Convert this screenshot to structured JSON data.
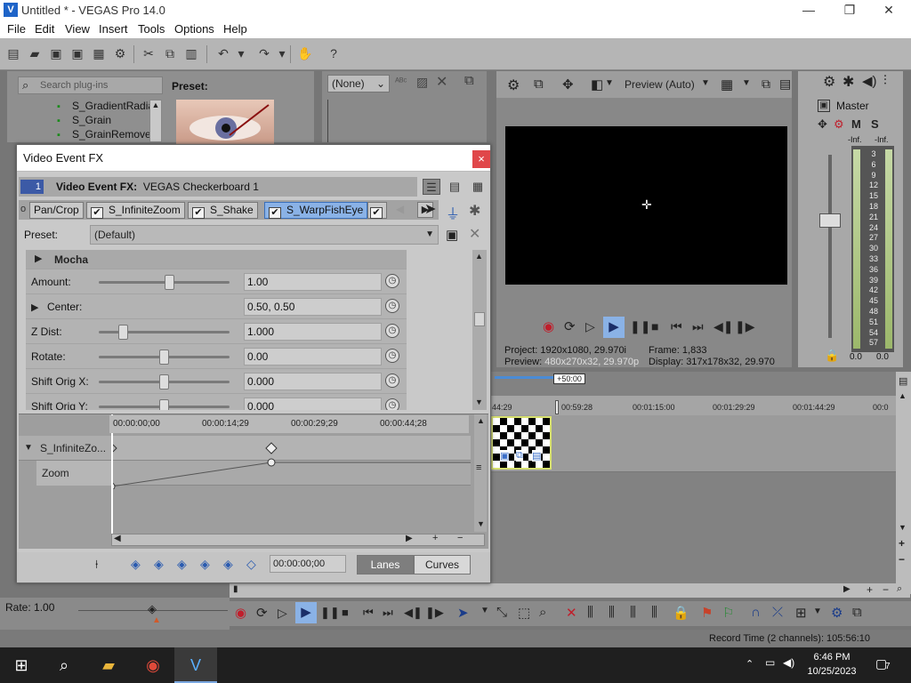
{
  "window": {
    "title": "Untitled * - VEGAS Pro 14.0",
    "icon": "vegas-logo-icon",
    "minimize": "—",
    "restore": "❐",
    "close": "✕"
  },
  "menu": [
    "File",
    "Edit",
    "View",
    "Insert",
    "Tools",
    "Options",
    "Help"
  ],
  "plugins": {
    "search_placeholder": "Search plug-ins",
    "items": [
      "S_GradientRadial",
      "S_Grain",
      "S_GrainRemove"
    ],
    "preset_label": "Preset:"
  },
  "trimmer": {
    "selection": "(None)"
  },
  "preview": {
    "mode": "Preview (Auto)",
    "project_label": "Project:",
    "project_value": "1920x1080, 29.970i",
    "preview_label": "Preview:",
    "preview_value": "480x270x32, 29.970p",
    "frame_label": "Frame:",
    "frame_value": "1,833",
    "display_label": "Display:",
    "display_value": "317x178x32, 29.970"
  },
  "mixer": {
    "master": "Master",
    "inf_left": "-Inf.",
    "inf_right": "-Inf.",
    "meter_labels": [
      "3",
      "6",
      "9",
      "12",
      "15",
      "18",
      "21",
      "24",
      "27",
      "30",
      "33",
      "36",
      "39",
      "42",
      "45",
      "48",
      "51",
      "54",
      "57"
    ],
    "bottom_left": "0.0",
    "bottom_right": "0.0"
  },
  "timeline": {
    "ticks": [
      "44:29",
      "00:59:28",
      "00:01:15:00",
      "00:01:29:29",
      "00:01:44:29",
      "00:0"
    ],
    "marker": "+50:00"
  },
  "dialog": {
    "title": "Video Event FX",
    "close": "×",
    "badge": "1",
    "header_label": "Video Event FX:",
    "header_value": "VEGAS Checkerboard 1",
    "chain": [
      "Pan/Crop",
      "S_InfiniteZoom",
      "S_Shake",
      "S_WarpFishEye"
    ],
    "preset_label": "Preset:",
    "preset_value": "(Default)",
    "group": "Mocha",
    "params": [
      {
        "label": "Amount:",
        "value": "1.00"
      },
      {
        "label": "Center:",
        "value": "0.50, 0.50"
      },
      {
        "label": "Z Dist:",
        "value": "1.000"
      },
      {
        "label": "Rotate:",
        "value": "0.00"
      },
      {
        "label": "Shift Orig X:",
        "value": "0.000"
      },
      {
        "label": "Shift Orig Y:",
        "value": "0.000"
      }
    ],
    "keyframes": {
      "ruler": [
        "00:00:00;00",
        "00:00:14;29",
        "00:00:29;29",
        "00:00:44;28"
      ],
      "track": "S_InfiniteZo...",
      "subtrack": "Zoom"
    },
    "timecode": "00:00:00;00",
    "lanes": "Lanes",
    "curves": "Curves"
  },
  "rate": "Rate: 1.00",
  "status": {
    "record_time": "Record Time (2 channels): 105:56:10"
  },
  "clock": {
    "time": "6:46 PM",
    "date": "10/25/2023"
  },
  "notifications": "7"
}
